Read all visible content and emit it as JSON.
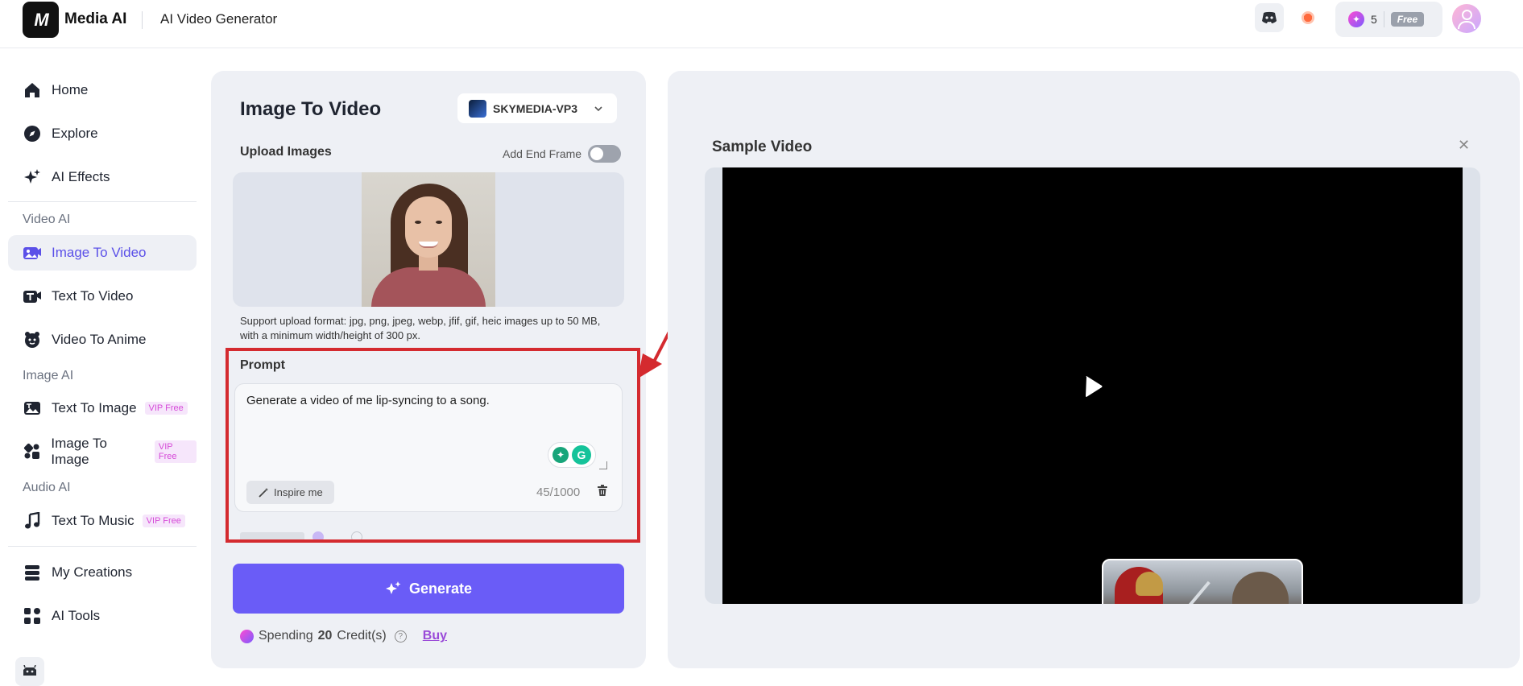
{
  "topbar": {
    "logo_text": "M",
    "brand": "Media AI",
    "title": "AI Video Generator",
    "credits_count": "5",
    "plan_label": "Free"
  },
  "sidebar": {
    "home": "Home",
    "explore": "Explore",
    "ai_effects": "AI Effects",
    "section_video": "Video AI",
    "image_to_video": "Image To Video",
    "text_to_video": "Text To Video",
    "video_to_anime": "Video To Anime",
    "section_image": "Image AI",
    "text_to_image": "Text To Image",
    "image_to_image": "Image To Image",
    "section_audio": "Audio AI",
    "text_to_music": "Text To Music",
    "vip_label": "VIP Free",
    "my_creations": "My Creations",
    "ai_tools": "AI Tools"
  },
  "panel": {
    "title": "Image To Video",
    "model": "SKYMEDIA-VP3",
    "upload_label": "Upload Images",
    "end_frame_label": "Add End Frame",
    "support_text": "Support upload format: jpg, png, jpeg, webp, jfif, gif, heic images up to 50 MB, with a minimum width/height of 300 px.",
    "prompt_label": "Prompt",
    "prompt_value": "Generate a video of me lip-syncing to a song.",
    "inspire_label": "Inspire me",
    "counter": "45/1000",
    "generate_label": "Generate",
    "spending_prefix": "Spending",
    "spending_amount": "20",
    "spending_suffix": "Credit(s)",
    "buy_label": "Buy"
  },
  "preview": {
    "title": "Sample Video"
  },
  "colors": {
    "accent": "#6a5cf7",
    "active_nav": "#5b50e8",
    "highlight": "#d42a2f"
  }
}
